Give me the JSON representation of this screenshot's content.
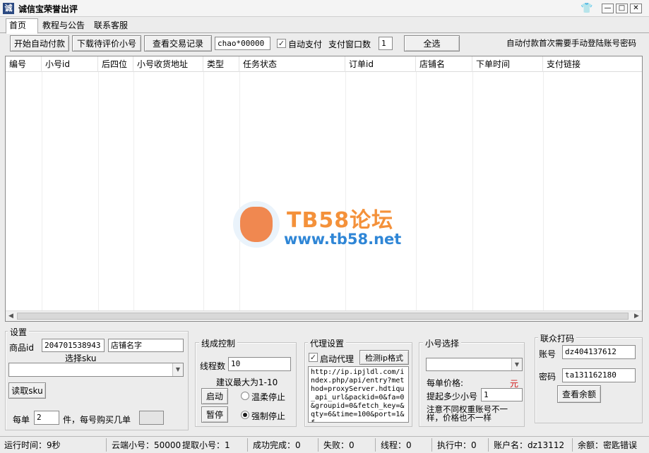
{
  "window": {
    "title": "诚信宝荣誉出评",
    "icon": "app-logo-icon"
  },
  "tabs": [
    {
      "label": "首页"
    },
    {
      "label": "教程与公告"
    },
    {
      "label": "联系客服"
    }
  ],
  "toolbar": {
    "start_button": "开始自动付款",
    "download_button": "下载待评价小号",
    "view_records_button": "查看交易记录",
    "account_field": "chao*00000",
    "auto_pay_label": "自动支付",
    "auto_pay_checked": true,
    "pay_window_label": "支付窗口数",
    "pay_window_value": "1",
    "select_all_button": "全选",
    "notice": "自动付款首次需要手动登陆账号密码"
  },
  "table": {
    "columns": [
      "编号",
      "小号id",
      "后四位",
      "小号收货地址",
      "类型",
      "任务状态",
      "订单id",
      "店铺名",
      "下单时间",
      "支付链接"
    ],
    "rows": []
  },
  "watermark": {
    "title": "TB58论坛",
    "url": "www.tb58.net"
  },
  "settings": {
    "legend": "设置",
    "product_id_label": "商品id",
    "product_id_value": "204701538943",
    "shop_name_value": "店铺名字",
    "select_sku_label": "选择sku",
    "sku_value": "",
    "read_sku_button": "读取sku",
    "per_order_label": "每单",
    "per_order_value": "2",
    "per_order_suffix": "件，每号购买几单",
    "per_account_value": ""
  },
  "thread_control": {
    "legend": "线成控制",
    "thread_count_label": "线程数",
    "thread_count_value": "10",
    "suggest_text": "建议最大为1-10",
    "start_button": "启动",
    "pause_button": "暂停",
    "gentle_stop_label": "温柔停止",
    "force_stop_label": "强制停止",
    "selected_stop": "force"
  },
  "proxy": {
    "legend": "代理设置",
    "enable_label": "启动代理",
    "enable_checked": true,
    "check_button": "检测ip格式",
    "url": "http://ip.ipjldl.com/index.php/api/entry?method=proxyServer.hdtiqu_api_url&packid=0&fa=0&groupid=0&fetch_key=&qty=6&time=100&port=1&f"
  },
  "account_select": {
    "legend": "小号选择",
    "combo_value": "",
    "price_label": "每单价格:",
    "price_unit": "元",
    "min_label": "提起多少小号",
    "min_value": "1",
    "note": "注意不同权重账号不一样，价格也不一样"
  },
  "captcha": {
    "legend": "联众打码",
    "account_label": "账号",
    "account_value": "dz404137612",
    "password_label": "密码",
    "password_value": "ta131162180",
    "balance_button": "查看余额"
  },
  "status": {
    "runtime": "运行时间：9秒",
    "cloud": "云端小号：50000",
    "fetched": "提取小号：1",
    "success": "成功完成：0",
    "failed": "失败：0",
    "threads": "线程：0",
    "running": "执行中：0",
    "account": "账户名：dz13112",
    "balance": "余额：密匙错误"
  },
  "colors": {
    "watermark_orange": "#f4913a",
    "watermark_blue": "#2f86d6",
    "price_unit": "#d21a1a"
  }
}
